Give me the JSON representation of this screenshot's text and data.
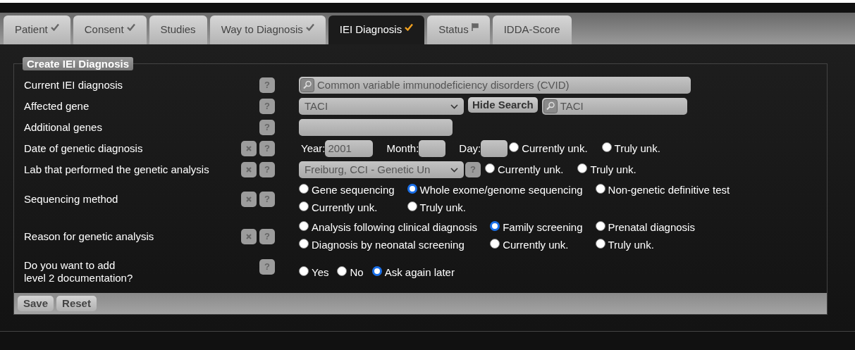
{
  "tabs": [
    {
      "label": "Patient",
      "selected": false,
      "kind": "check"
    },
    {
      "label": "Consent",
      "selected": false,
      "kind": "check"
    },
    {
      "label": "Studies",
      "selected": false,
      "kind": "plain"
    },
    {
      "label": "Way to Diagnosis",
      "selected": false,
      "kind": "check"
    },
    {
      "label": "IEI Diagnosis",
      "selected": true,
      "kind": "check"
    },
    {
      "label": "Status",
      "selected": false,
      "kind": "flag"
    },
    {
      "label": "IDDA-Score",
      "selected": false,
      "kind": "plain"
    }
  ],
  "form": {
    "title": "Create IEI Diagnosis",
    "rows": [
      {
        "label": "Current IEI diagnosis",
        "clearable": false,
        "help": "?",
        "control": {
          "kind": "search",
          "value": "Common variable immunodeficiency disorders (CVID)"
        }
      },
      {
        "label": "Affected gene",
        "clearable": false,
        "help": "?",
        "control": {
          "kind": "gene",
          "select_value": "TACI",
          "button": "Hide Search",
          "search_value": "TACI"
        }
      },
      {
        "label": "Additional genes",
        "clearable": false,
        "help": "?",
        "control": {
          "kind": "text"
        }
      },
      {
        "label": "Date of genetic diagnosis",
        "clearable": true,
        "help": "?",
        "control": {
          "kind": "date",
          "parts": [
            {
              "label": "Year:",
              "value": "2001"
            },
            {
              "label": "Month:"
            },
            {
              "label": "Day:"
            }
          ],
          "options": [
            {
              "label": "Currently unk.",
              "selected": false
            },
            {
              "label": "Truly unk.",
              "selected": false
            }
          ]
        }
      },
      {
        "label": "Lab that performed the genetic analysis",
        "clearable": true,
        "help": "?",
        "control": {
          "kind": "lab",
          "select_value": "Freiburg, CCI - Genetic Un",
          "help": "?",
          "options": [
            {
              "label": "Currently unk.",
              "selected": false
            },
            {
              "label": "Truly unk.",
              "selected": false
            }
          ]
        }
      },
      {
        "label": "Sequencing method",
        "clearable": true,
        "help": "?",
        "control": {
          "kind": "radios",
          "options": [
            {
              "label": "Gene sequencing",
              "selected": false
            },
            {
              "label": "Whole exome/genome sequencing",
              "selected": true
            },
            {
              "label": "Non-genetic definitive test",
              "selected": false
            },
            {
              "label": "Currently unk.",
              "selected": false
            },
            {
              "label": "Truly unk.",
              "selected": false
            }
          ]
        }
      },
      {
        "label": "Reason for genetic analysis",
        "clearable": true,
        "help": "?",
        "control": {
          "kind": "radios",
          "options": [
            {
              "label": "Analysis following clinical diagnosis",
              "selected": false
            },
            {
              "label": "Family screening",
              "selected": true
            },
            {
              "label": "Prenatal diagnosis",
              "selected": false
            },
            {
              "label": "Diagnosis by neonatal screening",
              "selected": false
            },
            {
              "label": "Currently unk.",
              "selected": false
            },
            {
              "label": "Truly unk.",
              "selected": false
            }
          ]
        }
      },
      {
        "label": "Do you want to add\nlevel 2 documentation?",
        "clearable": false,
        "help": "?",
        "control": {
          "kind": "inline",
          "options": [
            {
              "label": "Yes",
              "selected": false
            },
            {
              "label": "No",
              "selected": false
            },
            {
              "label": "Ask again later",
              "selected": true
            }
          ]
        }
      }
    ],
    "buttons": [
      "Save",
      "Reset"
    ]
  }
}
